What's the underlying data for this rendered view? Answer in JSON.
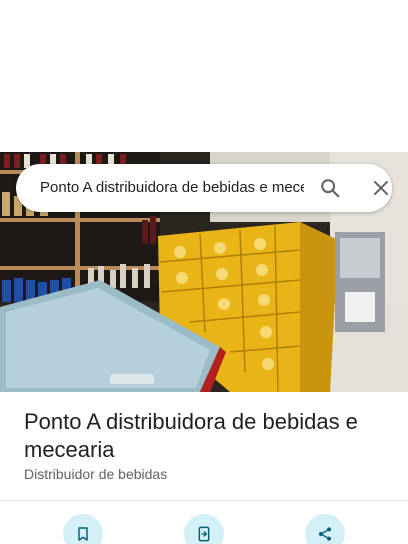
{
  "search": {
    "query": "Ponto A distribuidora de bebidas e mecearia",
    "search_icon": "search-icon",
    "close_icon": "close-icon"
  },
  "photo": {
    "description_icon": "place-photo"
  },
  "place": {
    "name": "Ponto A distribuidora de bebidas e mecearia",
    "category": "Distribuidor de bebidas"
  },
  "actions": [
    {
      "icon": "bookmark-icon"
    },
    {
      "icon": "send-to-phone-icon"
    },
    {
      "icon": "share-icon"
    }
  ],
  "colors": {
    "action_bg": "#d3f0f7",
    "icon": "#0b5f73",
    "title": "#202124",
    "subtitle": "#5f6368"
  }
}
